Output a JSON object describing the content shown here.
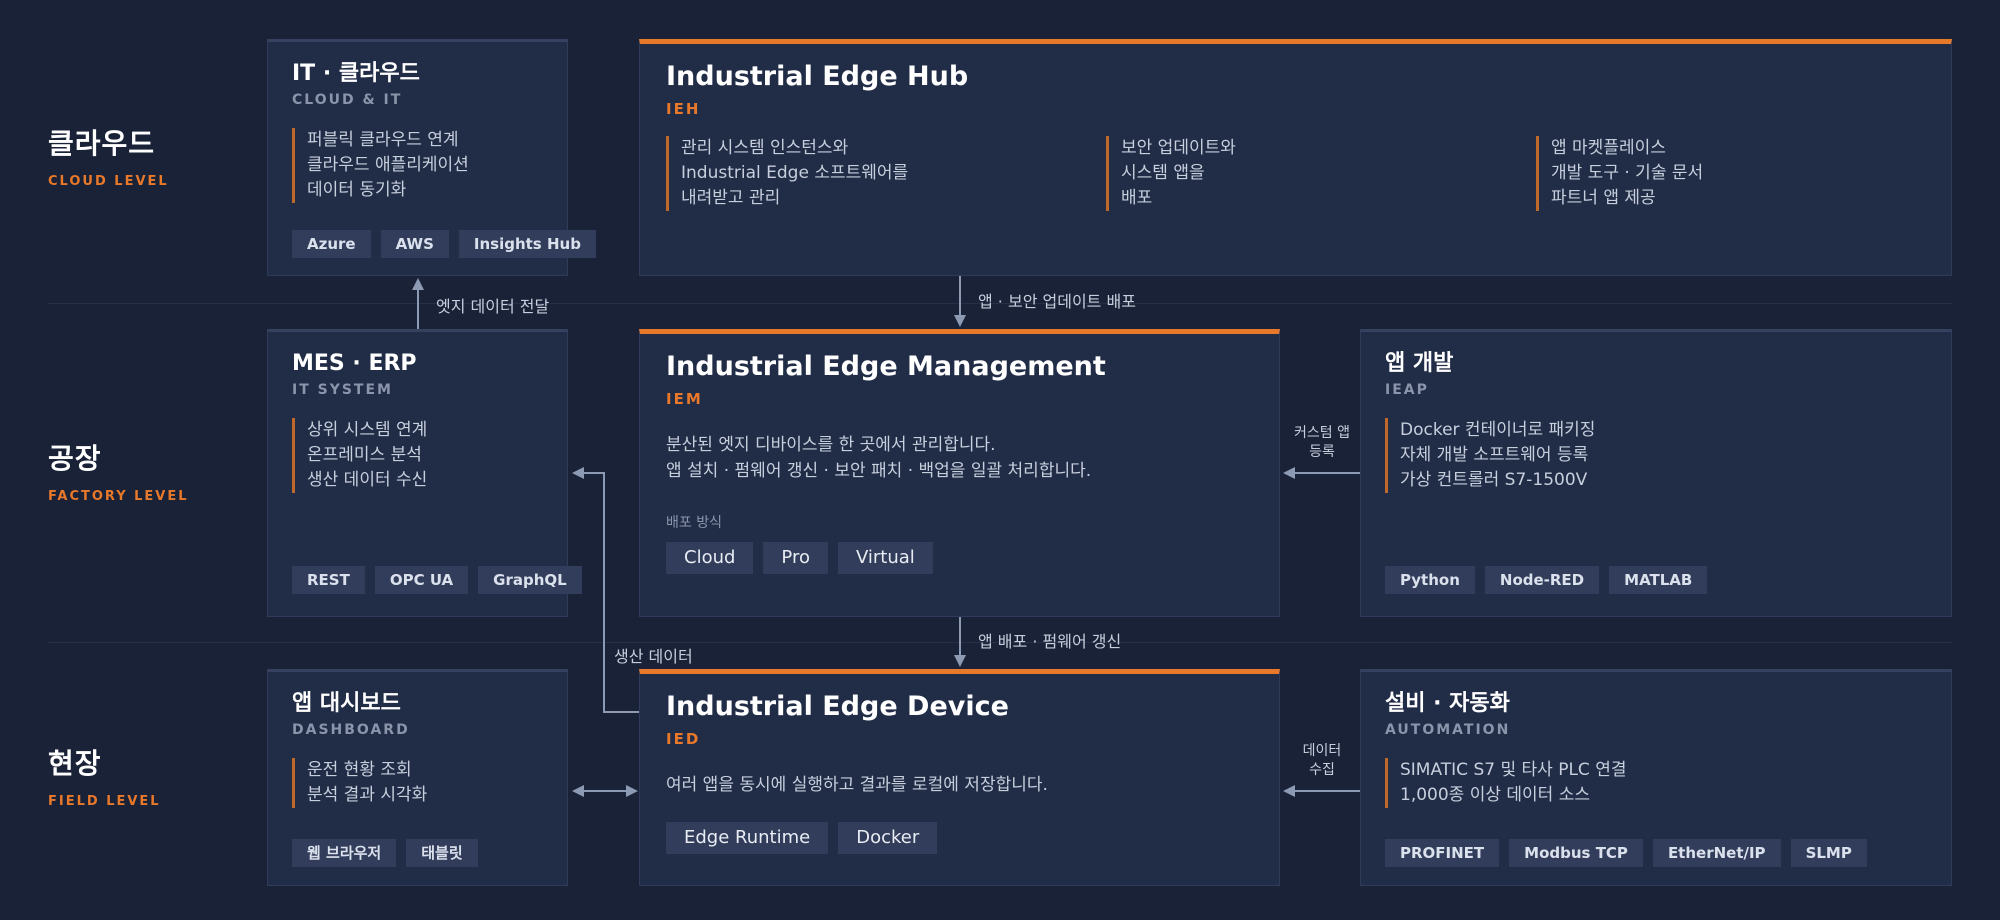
{
  "levels": {
    "cloud": {
      "title": "클라우드",
      "sub": "CLOUD LEVEL"
    },
    "factory": {
      "title": "공장",
      "sub": "FACTORY LEVEL"
    },
    "field": {
      "title": "현장",
      "sub": "FIELD LEVEL"
    }
  },
  "it_cloud": {
    "title": "IT · 클라우드",
    "sub": "CLOUD & IT",
    "bullets": [
      "퍼블릭 클라우드 연계",
      "클라우드 애플리케이션",
      "데이터 동기화"
    ],
    "tags": [
      "Azure",
      "AWS",
      "Insights Hub"
    ]
  },
  "hub": {
    "title": "Industrial Edge Hub",
    "sub": "IEH",
    "col1": [
      "관리 시스템 인스턴스와",
      "Industrial Edge 소프트웨어를",
      "내려받고 관리"
    ],
    "col2": [
      "보안 업데이트와",
      "시스템 앱을",
      "배포"
    ],
    "col3": [
      "앱 마켓플레이스",
      "개발 도구 · 기술 문서",
      "파트너 앱 제공"
    ]
  },
  "mes": {
    "title": "MES · ERP",
    "sub": "IT SYSTEM",
    "bullets": [
      "상위 시스템 연계",
      "온프레미스 분석",
      "생산 데이터 수신"
    ],
    "tags": [
      "REST",
      "OPC UA",
      "GraphQL"
    ]
  },
  "iem": {
    "title": "Industrial Edge Management",
    "sub": "IEM",
    "desc": [
      "분산된 엣지 디바이스를 한 곳에서 관리합니다.",
      "앱 설치 · 펌웨어 갱신 · 보안 패치 · 백업을 일괄 처리합니다."
    ],
    "deploy_label": "배포 방식",
    "tags": [
      "Cloud",
      "Pro",
      "Virtual"
    ]
  },
  "ieap": {
    "title": "앱 개발",
    "sub": "IEAP",
    "bullets": [
      "Docker 컨테이너로 패키징",
      "자체 개발 소프트웨어 등록",
      "가상 컨트롤러 S7-1500V"
    ],
    "tags": [
      "Python",
      "Node-RED",
      "MATLAB"
    ]
  },
  "dashboard": {
    "title": "앱 대시보드",
    "sub": "DASHBOARD",
    "bullets": [
      "운전 현황 조회",
      "분석 결과 시각화"
    ],
    "tags": [
      "웹 브라우저",
      "태블릿"
    ]
  },
  "ied": {
    "title": "Industrial Edge Device",
    "sub": "IED",
    "desc": [
      "여러 앱을 동시에 실행하고 결과를 로컬에 저장합니다."
    ],
    "tags": [
      "Edge Runtime",
      "Docker"
    ]
  },
  "automation": {
    "title": "설비 · 자동화",
    "sub": "AUTOMATION",
    "bullets": [
      "SIMATIC S7 및 타사 PLC 연결",
      "1,000종 이상 데이터 소스"
    ],
    "tags": [
      "PROFINET",
      "Modbus TCP",
      "EtherNet/IP",
      "SLMP"
    ]
  },
  "arrows": {
    "edge_to_cloud": "엣지 데이터 전달",
    "hub_to_iem": "앱 · 보안 업데이트 배포",
    "iem_to_ied": "앱 배포 · 펌웨어 갱신",
    "production_data": "생산 데이터",
    "custom_app": [
      "커스텀 앱",
      "등록"
    ],
    "data_collect": [
      "데이터",
      "수집"
    ]
  },
  "colors": {
    "background": "#1a2238",
    "card": "#212c47",
    "accent": "#e8782a",
    "connector": "#8d9ab4"
  }
}
